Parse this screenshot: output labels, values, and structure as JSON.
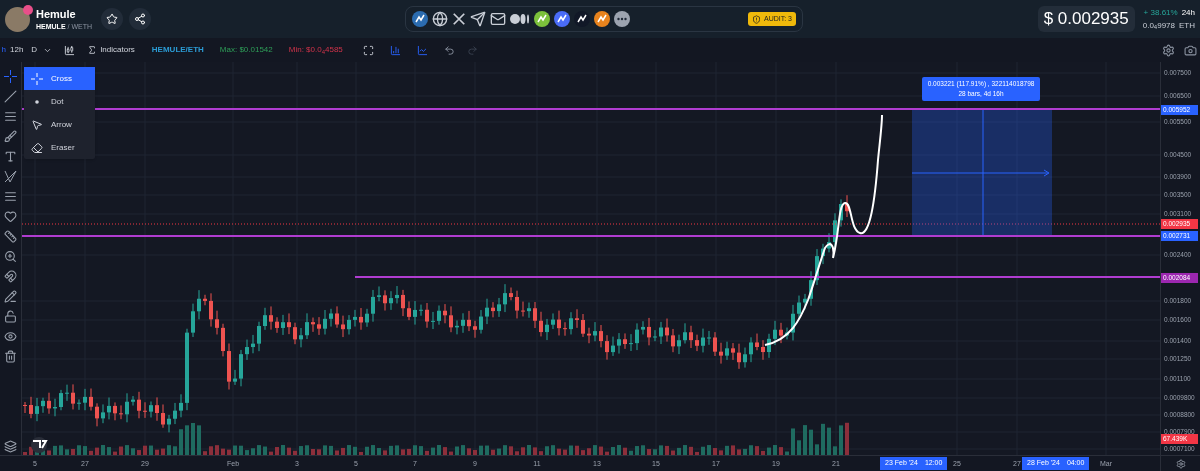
{
  "token": {
    "name": "Hemule",
    "symbol": "HEMULE",
    "separator": "/",
    "pair": "WETH"
  },
  "audit": "AUDIT: 3",
  "price": {
    "usd": "$ 0.002935",
    "change": "+ 38.61%",
    "period": "24h",
    "eth": "0.0$_{4}$9978",
    "eth_unit": "ETH"
  },
  "toolbar": {
    "timeframes": [
      {
        "label": "h",
        "selected": true
      },
      {
        "label": "12h",
        "selected": false
      },
      {
        "label": "D",
        "selected": false
      }
    ],
    "indicators": "Indicators",
    "pair": "HEMULE/ETH",
    "max": "Max: $0.01542",
    "min": "Min: $0.0$_{4}$4585"
  },
  "cursor_menu": [
    {
      "kind": "cross",
      "label": "Cross",
      "selected": true
    },
    {
      "kind": "dot",
      "label": "Dot",
      "selected": false
    },
    {
      "kind": "arrow",
      "label": "Arrow",
      "selected": false
    },
    {
      "kind": "eraser",
      "label": "Eraser",
      "selected": false
    }
  ],
  "chart": {
    "price_ticks": [
      "0.007500",
      "0.006500",
      "0.005500",
      "0.004500",
      "0.003900",
      "0.003500",
      "0.003100",
      "0.002400",
      "0.001800",
      "0.001600",
      "0.001400",
      "0.001250",
      "0.001100",
      "0.0009800",
      "0.0008800",
      "0.0007900",
      "0.0007100"
    ],
    "level_labels": [
      {
        "label": "0.005952",
        "color": "#2962ff"
      },
      {
        "label": "0.002935",
        "color": "#f23645"
      },
      {
        "label": "0.002731",
        "color": "#2962ff"
      },
      {
        "label": "0.002084",
        "color": "#9c27b0"
      },
      {
        "label": "67.439K",
        "color": "#f23645"
      }
    ],
    "measure": {
      "line1": "0.003221 (117.91%) , 322114018798",
      "line2": "28 bars, 4d 16h"
    },
    "date_ticks": [
      "5",
      "27",
      "29",
      "Feb",
      "3",
      "5",
      "7",
      "9",
      "11",
      "13",
      "15",
      "17",
      "19",
      "21",
      "25",
      "27",
      "Mar"
    ],
    "crosshair_dates": [
      {
        "date": "23 Feb '24",
        "time": "12:00"
      },
      {
        "date": "28 Feb '24",
        "time": "04:00"
      }
    ]
  }
}
